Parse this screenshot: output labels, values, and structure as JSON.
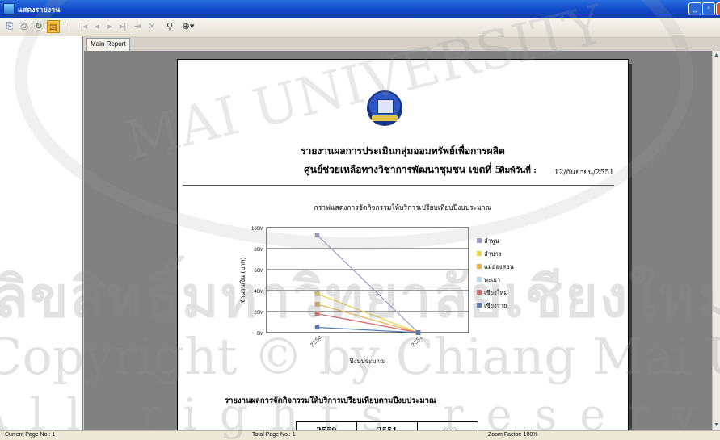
{
  "window": {
    "title": "แสดงรายงาน"
  },
  "toolbar": {
    "export_icon": "export-icon",
    "print_icon": "print-icon",
    "refresh_icon": "refresh-icon",
    "tree_icon": "group-tree-icon",
    "search_icon": "binoculars-icon",
    "zoom_icon": "zoom-icon"
  },
  "tabs": [
    {
      "label": "Main Report"
    }
  ],
  "report": {
    "title_line1": "รายงานผลการประเมินกลุ่มออมทรัพย์เพื่อการผลิต",
    "title_line2": "ศูนย์ช่วยเหลือทางวิชาการพัฒนาชุมชน เขตที่ 5",
    "date_label": "พิมพ์วันที่ :",
    "date_value": "12/กันยายน/2551",
    "chart_title": "กราฟแสดงการจัดกิจกรรมให้บริการเปรียบเทียบปีงบประมาณ",
    "table_title": "รายงานผลการจัดกิจกรรมให้บริการเปรียบเทียบตามปีงบประมาณ",
    "table_headers": [
      "2550",
      "2551",
      "รวม"
    ]
  },
  "chart_data": {
    "type": "line",
    "x": [
      "2550",
      "2551"
    ],
    "xlabel": "ปีงบประมาณ",
    "ylabel": "จำนวนเงิน (บาท)",
    "ylim": [
      0,
      100000000
    ],
    "yticks": [
      "0M",
      "20M",
      "40M",
      "60M",
      "80M",
      "100M"
    ],
    "grid": true,
    "legend_position": "right",
    "series": [
      {
        "name": "ลำพูน",
        "color": "#9a9ac8",
        "values": [
          93000000,
          0
        ]
      },
      {
        "name": "ลำปาง",
        "color": "#e9d34c",
        "values": [
          37000000,
          0
        ]
      },
      {
        "name": "แม่ฮ่องสอน",
        "color": "#efb049",
        "values": [
          27000000,
          0
        ]
      },
      {
        "name": "พะเยา",
        "color": "#b5d3ef",
        "values": [
          18000000,
          0
        ]
      },
      {
        "name": "เชียงใหม่",
        "color": "#e06565",
        "values": [
          18000000,
          0
        ]
      },
      {
        "name": "เชียงราย",
        "color": "#4f7ab8",
        "values": [
          5000000,
          0
        ]
      }
    ]
  },
  "watermark": {
    "line1": "ลิขสิทธิ์มหาวิทยาลัยเชียงใหม่",
    "line2": "Copyright © by Chiang Mai University",
    "line3": "All rights reserved",
    "arc": "MAI UNIVERSITY"
  },
  "status": {
    "current_page": "Current Page No.: 1",
    "total_page": "Total Page No.: 1",
    "zoom": "Zoom Factor: 100%"
  }
}
